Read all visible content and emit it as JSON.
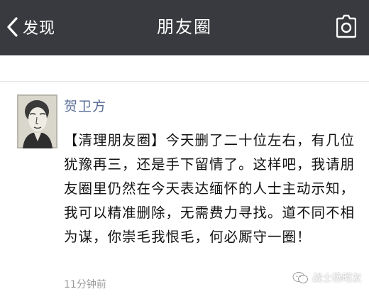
{
  "nav": {
    "back_label": "发现",
    "title": "朋友圈",
    "camera_icon": "camera-icon",
    "back_icon": "chevron-left-icon"
  },
  "post": {
    "author": "贺卫方",
    "text": "【清理朋友圈】今天删了二十位左右，有几位犹豫再三，还是手下留情了。这样吧，我请朋友圈里仍然在今天表达缅怀的人士主动示知，我可以精准删除，无需费力寻找。道不同不相为谋，你崇毛我恨毛，何必厮守一圈！",
    "time": "11分钟前"
  },
  "watermark": {
    "text": "战士杨昭友",
    "icon": "wechat-account-icon"
  },
  "colors": {
    "nav_background": "#383a3f",
    "author_link": "#576b95",
    "time_gray": "#9a9a9a"
  }
}
